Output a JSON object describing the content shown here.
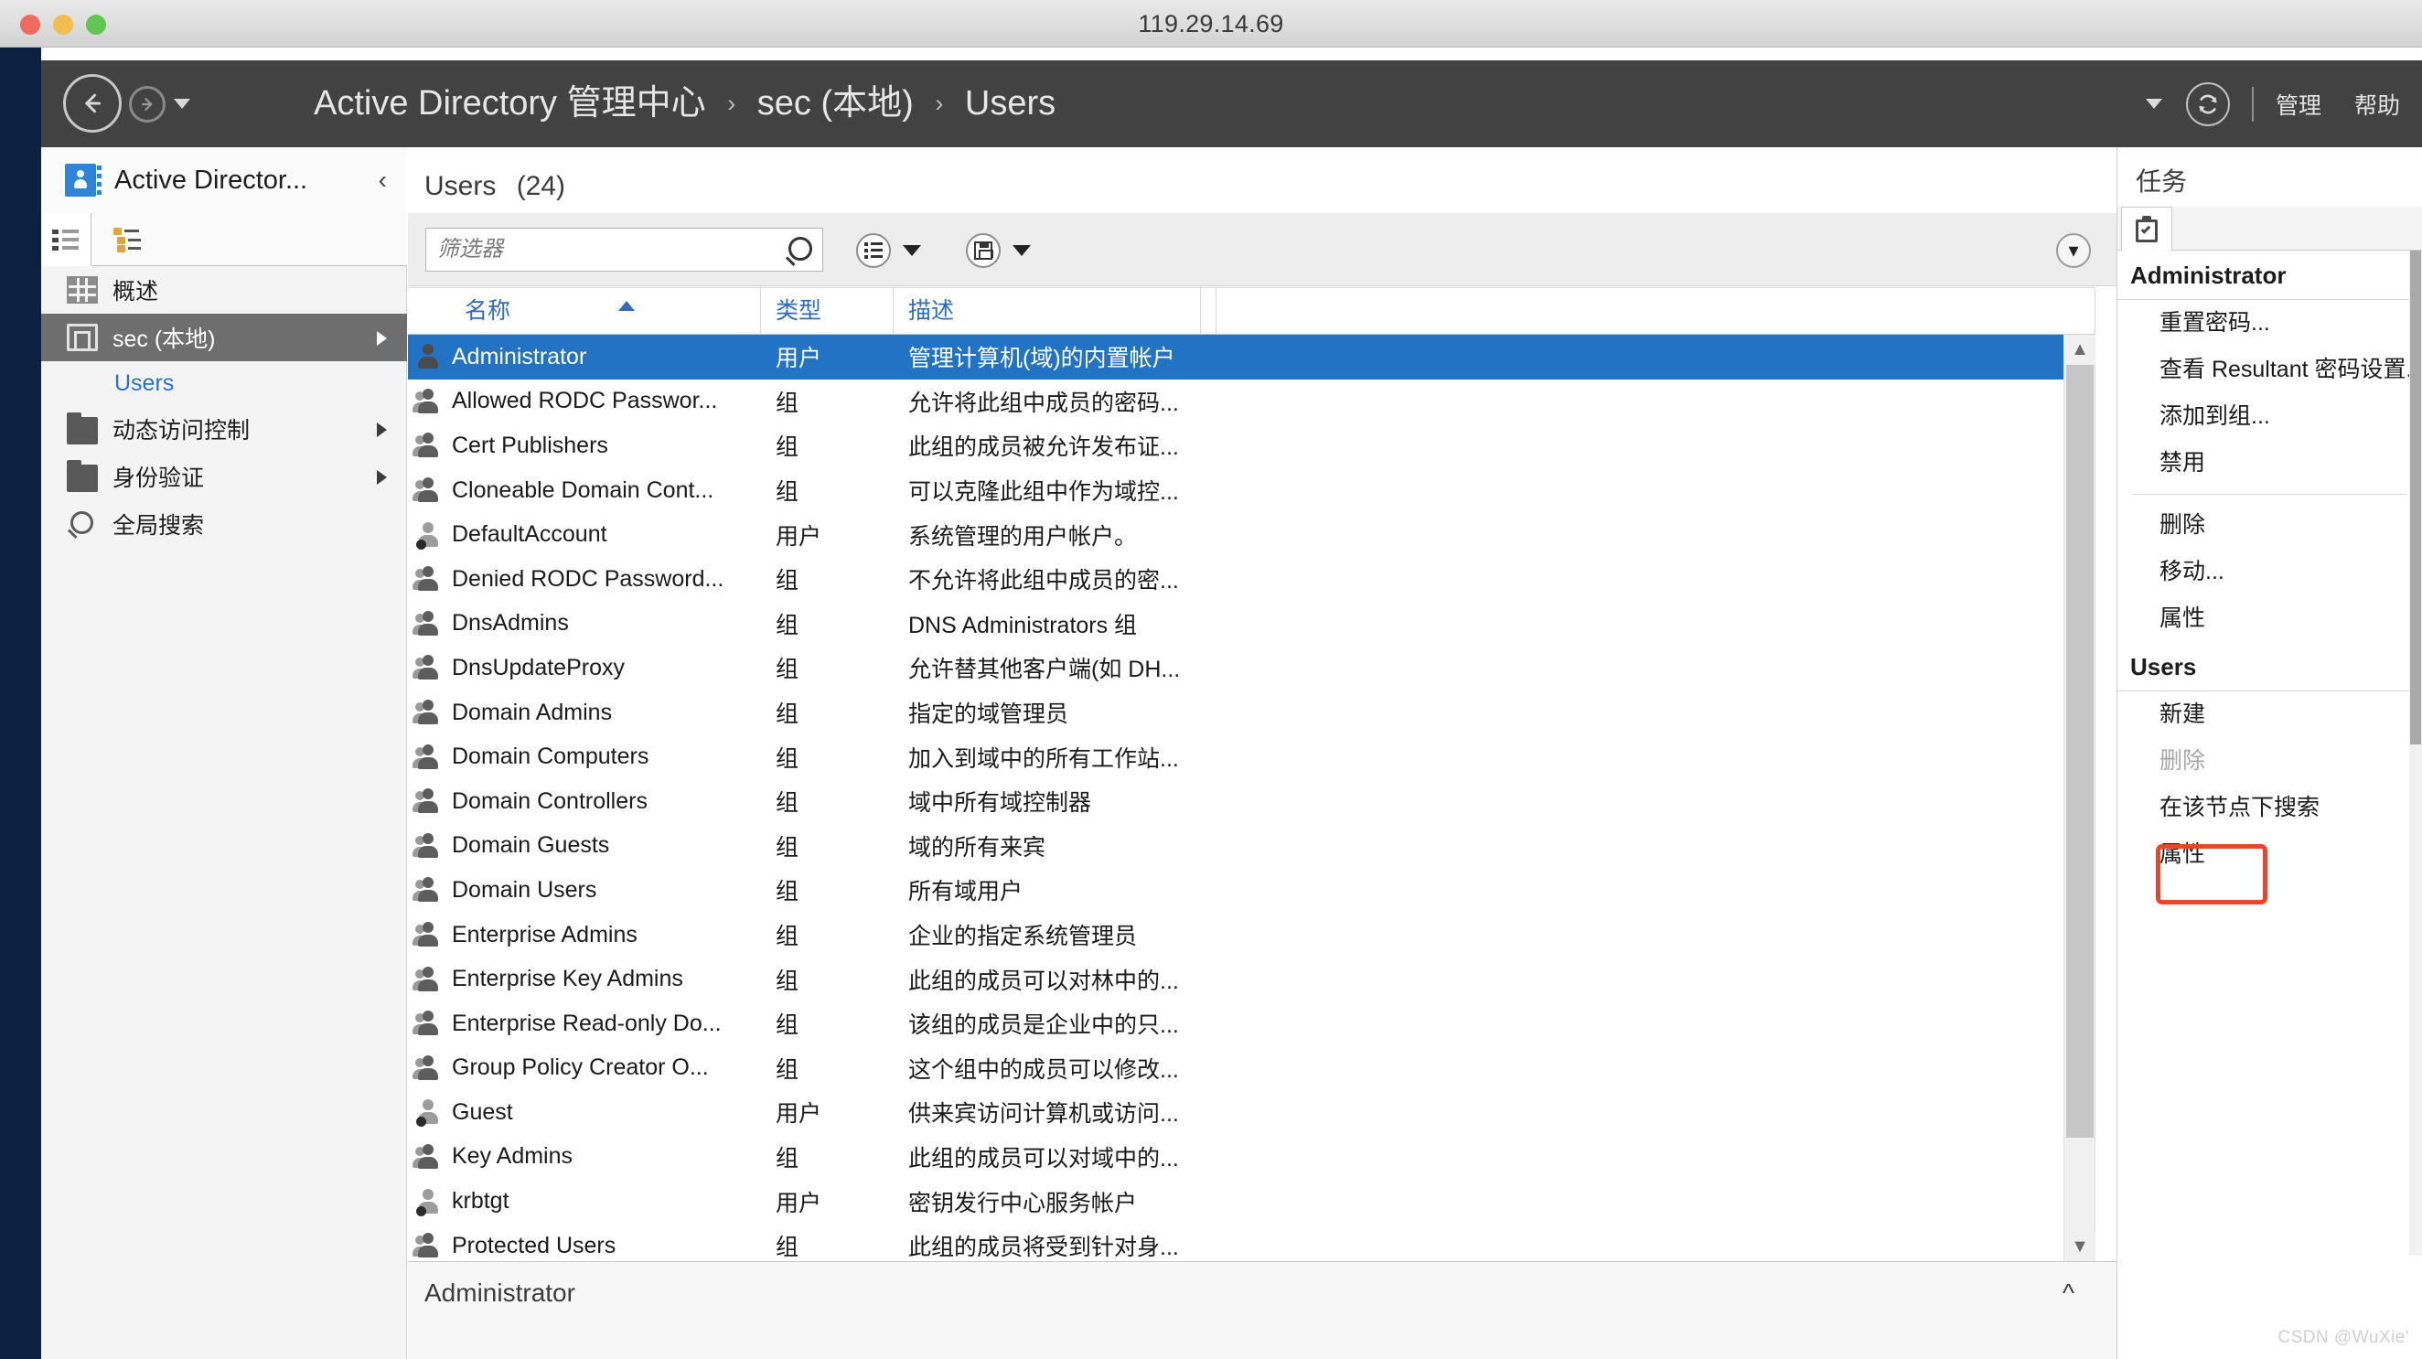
{
  "window": {
    "title": "119.29.14.69",
    "traffic_lights": [
      "close",
      "minimize",
      "maximize"
    ]
  },
  "header": {
    "back_icon": "back-arrow-icon",
    "forward_icon": "forward-arrow-icon",
    "history_caret_icon": "chevron-down-icon",
    "breadcrumb": [
      {
        "label": "Active Directory 管理中心"
      },
      {
        "label": "sec (本地)"
      },
      {
        "label": "Users"
      }
    ],
    "separator": "›",
    "caret_icon": "chevron-down-icon",
    "refresh_icon": "refresh-icon",
    "manage_label": "管理",
    "help_label": "帮助"
  },
  "sidebar": {
    "title": "Active Director...",
    "collapse_icon": "chevron-left-icon",
    "tabs": [
      {
        "icon": "list-view-icon",
        "active": true
      },
      {
        "icon": "tree-view-icon",
        "active": false
      }
    ],
    "items": [
      {
        "label": "概述",
        "icon": "grid-icon",
        "selected": false,
        "expandable": false,
        "child": false
      },
      {
        "label": "sec (本地)",
        "icon": "domain-icon",
        "selected": true,
        "expandable": true,
        "child": false
      },
      {
        "label": "Users",
        "icon": "",
        "selected": false,
        "expandable": false,
        "child": true
      },
      {
        "label": "动态访问控制",
        "icon": "folder-icon",
        "selected": false,
        "expandable": true,
        "child": false
      },
      {
        "label": "身份验证",
        "icon": "folder-icon",
        "selected": false,
        "expandable": true,
        "child": false
      },
      {
        "label": "全局搜索",
        "icon": "search-icon",
        "selected": false,
        "expandable": false,
        "child": false
      }
    ]
  },
  "content": {
    "title": "Users",
    "count": "(24)",
    "filter": {
      "placeholder": "筛选器",
      "value": "",
      "search_icon": "search-icon"
    },
    "toolbar": [
      {
        "icon": "columns-list-icon",
        "caret": "chevron-down-icon"
      },
      {
        "icon": "save-icon",
        "caret": "chevron-down-icon"
      }
    ],
    "expand_icon": "chevron-down-circle-icon",
    "columns": [
      {
        "label": "名称",
        "sorted": "asc"
      },
      {
        "label": "类型",
        "sorted": ""
      },
      {
        "label": "描述",
        "sorted": ""
      }
    ],
    "rows": [
      {
        "name": "Administrator",
        "type": "用户",
        "desc": "管理计算机(域)的内置帐户",
        "icon": "user-icon",
        "selected": true
      },
      {
        "name": "Allowed RODC Passwor...",
        "type": "组",
        "desc": "允许将此组中成员的密码...",
        "icon": "group-icon",
        "selected": false
      },
      {
        "name": "Cert Publishers",
        "type": "组",
        "desc": "此组的成员被允许发布证...",
        "icon": "group-icon",
        "selected": false
      },
      {
        "name": "Cloneable Domain Cont...",
        "type": "组",
        "desc": "可以克隆此组中作为域控...",
        "icon": "group-icon",
        "selected": false
      },
      {
        "name": "DefaultAccount",
        "type": "用户",
        "desc": "系统管理的用户帐户。",
        "icon": "user-disabled-icon",
        "selected": false
      },
      {
        "name": "Denied RODC Password...",
        "type": "组",
        "desc": "不允许将此组中成员的密...",
        "icon": "group-icon",
        "selected": false
      },
      {
        "name": "DnsAdmins",
        "type": "组",
        "desc": "DNS Administrators 组",
        "icon": "group-icon",
        "selected": false
      },
      {
        "name": "DnsUpdateProxy",
        "type": "组",
        "desc": "允许替其他客户端(如 DH...",
        "icon": "group-icon",
        "selected": false
      },
      {
        "name": "Domain Admins",
        "type": "组",
        "desc": "指定的域管理员",
        "icon": "group-icon",
        "selected": false
      },
      {
        "name": "Domain Computers",
        "type": "组",
        "desc": "加入到域中的所有工作站...",
        "icon": "group-icon",
        "selected": false
      },
      {
        "name": "Domain Controllers",
        "type": "组",
        "desc": "域中所有域控制器",
        "icon": "group-icon",
        "selected": false
      },
      {
        "name": "Domain Guests",
        "type": "组",
        "desc": "域的所有来宾",
        "icon": "group-icon",
        "selected": false
      },
      {
        "name": "Domain Users",
        "type": "组",
        "desc": "所有域用户",
        "icon": "group-icon",
        "selected": false
      },
      {
        "name": "Enterprise Admins",
        "type": "组",
        "desc": "企业的指定系统管理员",
        "icon": "group-icon",
        "selected": false
      },
      {
        "name": "Enterprise Key Admins",
        "type": "组",
        "desc": "此组的成员可以对林中的...",
        "icon": "group-icon",
        "selected": false
      },
      {
        "name": "Enterprise Read-only Do...",
        "type": "组",
        "desc": "该组的成员是企业中的只...",
        "icon": "group-icon",
        "selected": false
      },
      {
        "name": "Group Policy Creator O...",
        "type": "组",
        "desc": "这个组中的成员可以修改...",
        "icon": "group-icon",
        "selected": false
      },
      {
        "name": "Guest",
        "type": "用户",
        "desc": "供来宾访问计算机或访问...",
        "icon": "user-disabled-icon",
        "selected": false
      },
      {
        "name": "Key Admins",
        "type": "组",
        "desc": "此组的成员可以对域中的...",
        "icon": "group-icon",
        "selected": false
      },
      {
        "name": "krbtgt",
        "type": "用户",
        "desc": "密钥发行中心服务帐户",
        "icon": "user-disabled-icon",
        "selected": false
      },
      {
        "name": "Protected Users",
        "type": "组",
        "desc": "此组的成员将受到针对身...",
        "icon": "group-icon",
        "selected": false
      }
    ],
    "preview_label": "Administrator",
    "preview_chevron_icon": "chevron-up-icon",
    "scrollbar": {
      "up_icon": "chevron-up-icon",
      "down_icon": "chevron-down-icon"
    }
  },
  "tasks": {
    "title": "任务",
    "tab_icon": "clipboard-check-icon",
    "sections": [
      {
        "title": "Administrator",
        "items": [
          {
            "label": "重置密码...",
            "disabled": false
          },
          {
            "label": "查看 Resultant 密码设置...",
            "disabled": false
          },
          {
            "label": "添加到组...",
            "disabled": false
          },
          {
            "label": "禁用",
            "disabled": false
          },
          {
            "separator": true
          },
          {
            "label": "删除",
            "disabled": false
          },
          {
            "label": "移动...",
            "disabled": false
          },
          {
            "label": "属性",
            "disabled": false
          }
        ]
      },
      {
        "title": "Users",
        "items": [
          {
            "label": "新建",
            "disabled": false,
            "highlighted": true
          },
          {
            "label": "删除",
            "disabled": true
          },
          {
            "label": "在该节点下搜索",
            "disabled": false
          },
          {
            "label": "属性",
            "disabled": false
          }
        ]
      }
    ],
    "highlight_color": "#e8452a"
  },
  "watermark": "CSDN @WuXie'"
}
